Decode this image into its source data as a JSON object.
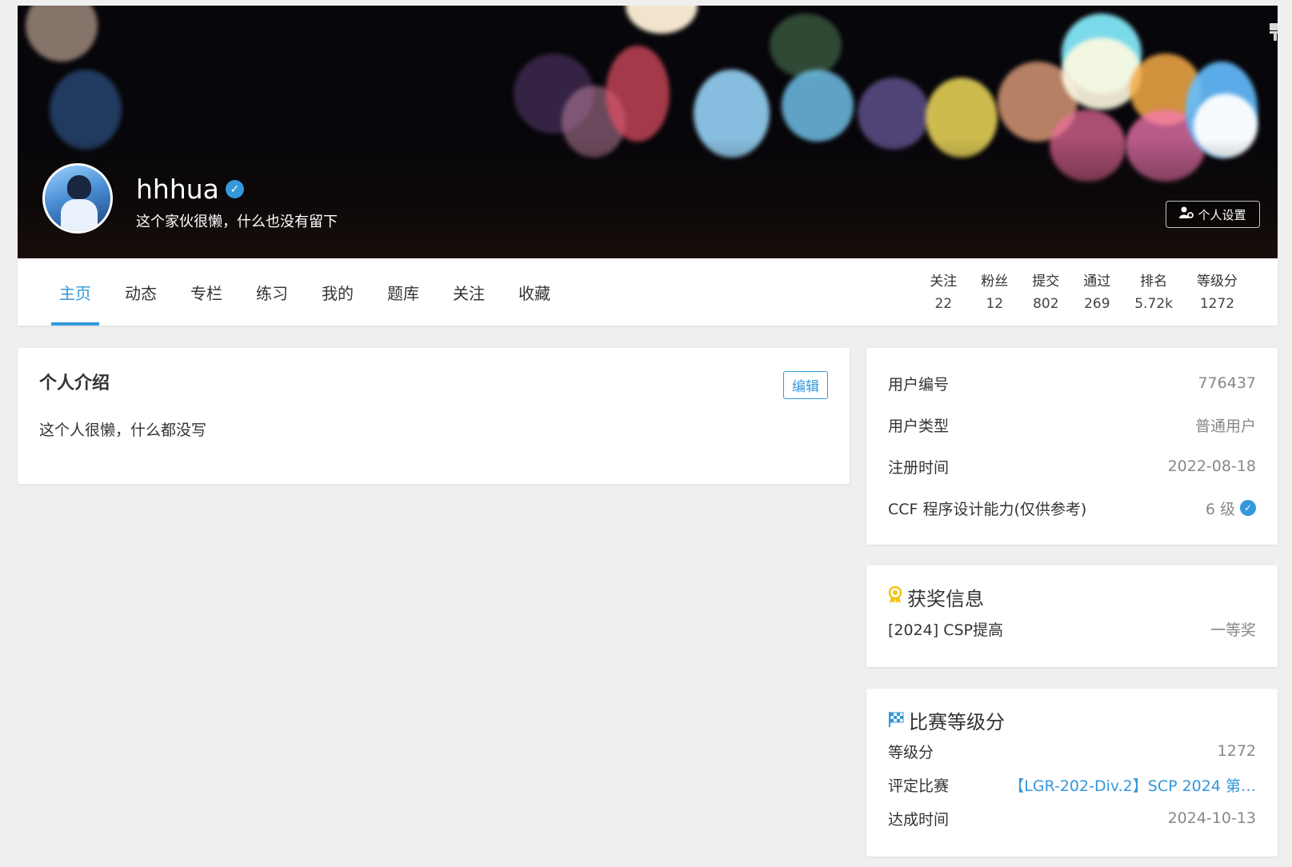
{
  "profile": {
    "username": "hhhua",
    "bio": "这个家伙很懒，什么也没有留下",
    "settings_label": "个人设置"
  },
  "nav": {
    "tabs": [
      "主页",
      "动态",
      "专栏",
      "练习",
      "我的",
      "题库",
      "关注",
      "收藏"
    ],
    "active_tab": "主页"
  },
  "stats": [
    {
      "label": "关注",
      "value": "22"
    },
    {
      "label": "粉丝",
      "value": "12"
    },
    {
      "label": "提交",
      "value": "802"
    },
    {
      "label": "通过",
      "value": "269"
    },
    {
      "label": "排名",
      "value": "5.72k"
    },
    {
      "label": "等级分",
      "value": "1272"
    }
  ],
  "intro": {
    "title": "个人介绍",
    "edit_label": "编辑",
    "text": "这个人很懒，什么都没写"
  },
  "info": [
    {
      "key": "用户编号",
      "value": "776437"
    },
    {
      "key": "用户类型",
      "value": "普通用户"
    },
    {
      "key": "注册时间",
      "value": "2022-08-18"
    },
    {
      "key": "CCF 程序设计能力(仅供参考)",
      "value": "6 级"
    }
  ],
  "awards": {
    "title": "获奖信息",
    "items": [
      {
        "name": "[2024] CSP提高",
        "level": "一等奖"
      }
    ]
  },
  "contest": {
    "title": "比赛等级分",
    "rating_label": "等级分",
    "rating_value": "1272",
    "contest_label": "评定比赛",
    "contest_value": "【LGR-202-Div.2】SCP 2024 第…",
    "date_label": "达成时间",
    "date_value": "2024-10-13"
  },
  "colors": {
    "accent": "#3498db",
    "background": "#efefef",
    "award_icon": "#f1c40f"
  }
}
